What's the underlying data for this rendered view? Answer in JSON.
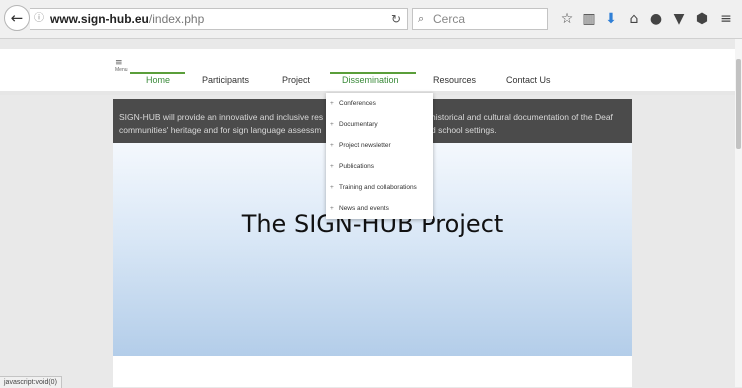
{
  "browser": {
    "url_domain": "www.sign-hub.eu",
    "url_path": "/index.php",
    "search_placeholder": "Cerca",
    "icons": [
      "back-arrow-icon",
      "info-icon",
      "reload-icon",
      "search-icon",
      "bookmark-star-icon",
      "reading-list-icon",
      "download-icon",
      "home-icon",
      "chat-icon",
      "pocket-icon",
      "shield-icon",
      "hamburger-menu-icon"
    ]
  },
  "site": {
    "menu_label": "Menu",
    "nav": [
      {
        "label": "Home"
      },
      {
        "label": "Participants"
      },
      {
        "label": "Project"
      },
      {
        "label": "Dissemination"
      },
      {
        "label": "Resources"
      },
      {
        "label": "Contact Us"
      }
    ],
    "dropdown": [
      {
        "label": "Conferences"
      },
      {
        "label": "Documentary"
      },
      {
        "label": "Project newsletter"
      },
      {
        "label": "Publications"
      },
      {
        "label": "Training and collaborations"
      },
      {
        "label": "News and events"
      }
    ],
    "hero_text_left_1": "SIGN-HUB will provide an innovative and inclusive res",
    "hero_text_left_2": "communities' heritage and for sign language assessm",
    "hero_text_right_1": "historical and cultural documentation of the Deaf",
    "hero_text_right_2": "d school settings.",
    "hero_title": "The SIGN-HUB Project"
  },
  "status_text": "javascript:void(0)",
  "colors": {
    "accent_green": "#5a9e3a",
    "dark_band": "#4b4b4b"
  }
}
